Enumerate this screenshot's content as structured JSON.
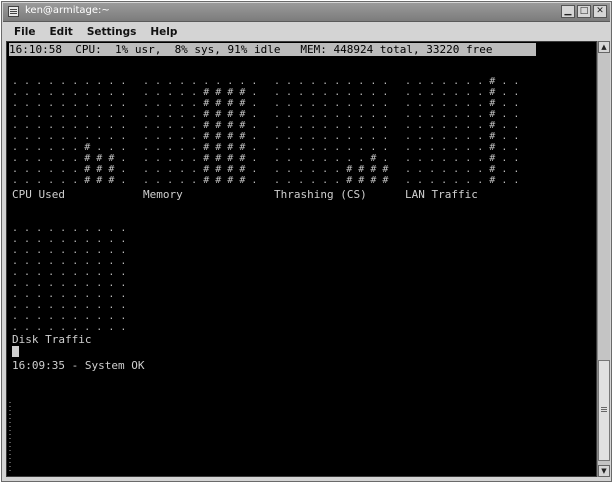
{
  "window": {
    "title": "ken@armitage:~",
    "buttons": {
      "minimize": "▁",
      "maximize": "□",
      "close": "✕"
    }
  },
  "menu": {
    "items": [
      "File",
      "Edit",
      "Settings",
      "Help"
    ]
  },
  "terminal": {
    "status_line": "16:10:58  CPU:  1% usr,  8% sys, 91% idle   MEM: 448924 total, 33220 free",
    "graphs": [
      {
        "label": "CPU Used",
        "levels": [
          1,
          1,
          1,
          1,
          1,
          1,
          4,
          3,
          3,
          1
        ]
      },
      {
        "label": "Memory",
        "levels": [
          1,
          1,
          1,
          1,
          1,
          9,
          9,
          9,
          9,
          1
        ]
      },
      {
        "label": "Thrashing (CS)",
        "levels": [
          1,
          1,
          1,
          1,
          1,
          1,
          2,
          2,
          3,
          2
        ]
      },
      {
        "label": "LAN Traffic",
        "levels": [
          1,
          1,
          1,
          1,
          1,
          1,
          1,
          10,
          1,
          1
        ]
      },
      {
        "label": "Disk Traffic",
        "levels": [
          1,
          1,
          1,
          1,
          1,
          1,
          1,
          1,
          1,
          1
        ]
      }
    ],
    "log": "16:09:35 - System OK"
  }
}
